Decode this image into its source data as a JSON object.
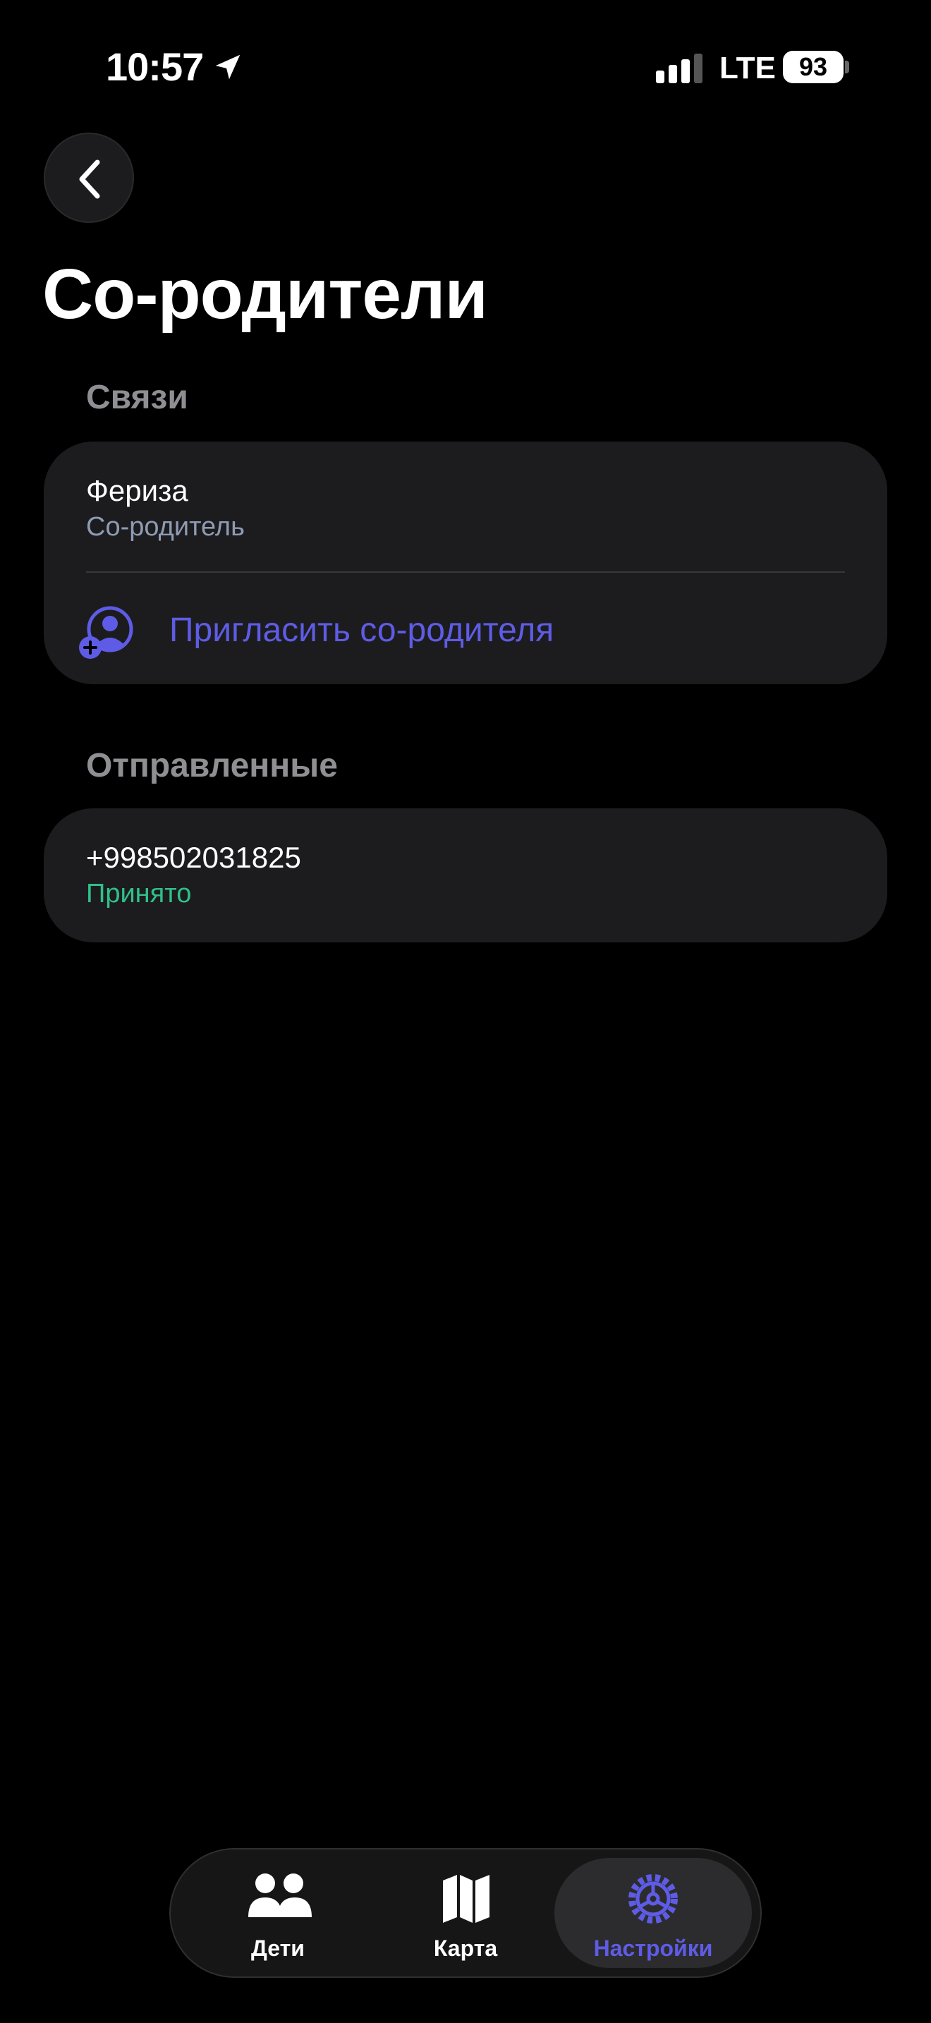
{
  "status_bar": {
    "time": "10:57",
    "network": "LTE",
    "battery": "93"
  },
  "page": {
    "title": "Со-родители"
  },
  "connections": {
    "section_label": "Связи",
    "items": [
      {
        "name": "Фериза",
        "role": "Со-родитель"
      }
    ],
    "invite_label": "Пригласить со-родителя"
  },
  "sent": {
    "section_label": "Отправленные",
    "items": [
      {
        "phone": "+998502031825",
        "status": "Принято"
      }
    ]
  },
  "tabbar": {
    "tabs": [
      {
        "label": "Дети",
        "icon": "people-icon"
      },
      {
        "label": "Карта",
        "icon": "map-icon"
      },
      {
        "label": "Настройки",
        "icon": "gear-icon"
      }
    ],
    "active_index": 2
  },
  "colors": {
    "accent": "#5e5ce6",
    "success": "#30c08a",
    "subtitle": "#8e9bb3",
    "card": "#1c1c1e"
  }
}
